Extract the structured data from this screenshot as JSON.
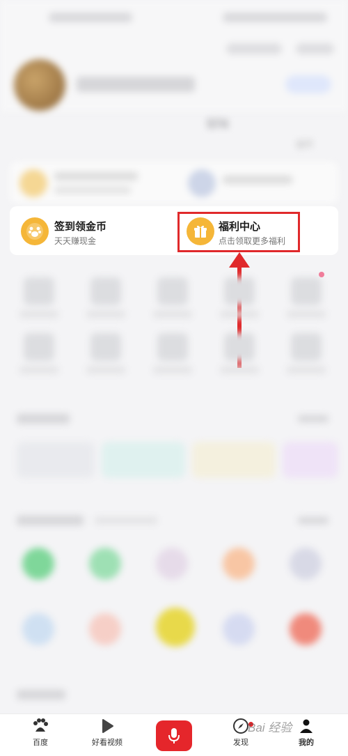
{
  "stats": [
    {
      "label": ""
    },
    {
      "label": ""
    },
    {
      "value": "574",
      "label": ""
    },
    {
      "label": "金币"
    }
  ],
  "entries": {
    "sign_in": {
      "title": "签到领金币",
      "subtitle": "天天赚现金"
    },
    "welfare": {
      "title": "福利中心",
      "subtitle": "点击领取更多福利"
    }
  },
  "bottom_nav": {
    "home": "百度",
    "video": "好看视频",
    "discover": "发现",
    "mine": "我的"
  },
  "watermark": "Bai 经验",
  "colors": {
    "accent": "#e0292b",
    "coin": "#f5b638"
  }
}
